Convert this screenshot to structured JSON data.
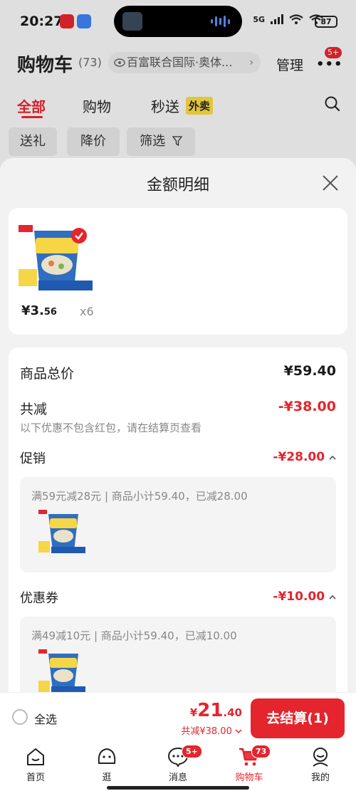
{
  "status_bar": {
    "time": "20:27",
    "network": "5G",
    "battery": "87"
  },
  "header": {
    "title": "购物车",
    "count": "(73)",
    "address": "百富联合国际·奥体...",
    "manage_label": "管理",
    "more_badge": "5+"
  },
  "tabs": [
    {
      "label": "全部"
    },
    {
      "label": "购物"
    },
    {
      "label": "秒送"
    }
  ],
  "waimai_tag": "外卖",
  "filters": [
    "送礼",
    "降价",
    "筛选"
  ],
  "sheet": {
    "title": "金额明细",
    "product": {
      "price_int": "¥3.",
      "price_dec": "56",
      "quantity": "x6"
    },
    "total_goods_label": "商品总价",
    "total_goods_value": "¥59.40",
    "discount_label": "共减",
    "discount_value": "-¥38.00",
    "discount_note": "以下优惠不包含红包，请在结算页查看",
    "promo": {
      "label": "促销",
      "value": "-¥28.00",
      "desc": "满59元减28元 | 商品小计59.40，已减28.00"
    },
    "coupon": {
      "label": "优惠券",
      "value": "-¥10.00",
      "desc": "满49减10元 | 商品小计59.40，已减10.00"
    }
  },
  "checkout": {
    "select_all": "全选",
    "total_symbol": "¥",
    "total_int": "21",
    "total_dec": ".40",
    "saved": "共减¥38.00",
    "pay_button": "去结算(1)"
  },
  "tabbar": [
    {
      "label": "首页",
      "icon": "home-icon"
    },
    {
      "label": "逛",
      "icon": "browse-icon"
    },
    {
      "label": "消息",
      "icon": "message-icon",
      "badge": "5+"
    },
    {
      "label": "购物车",
      "icon": "cart-icon",
      "badge": "73"
    },
    {
      "label": "我的",
      "icon": "profile-icon"
    }
  ],
  "colors": {
    "accent": "#e4252d",
    "tag_yellow": "#f5d742"
  }
}
